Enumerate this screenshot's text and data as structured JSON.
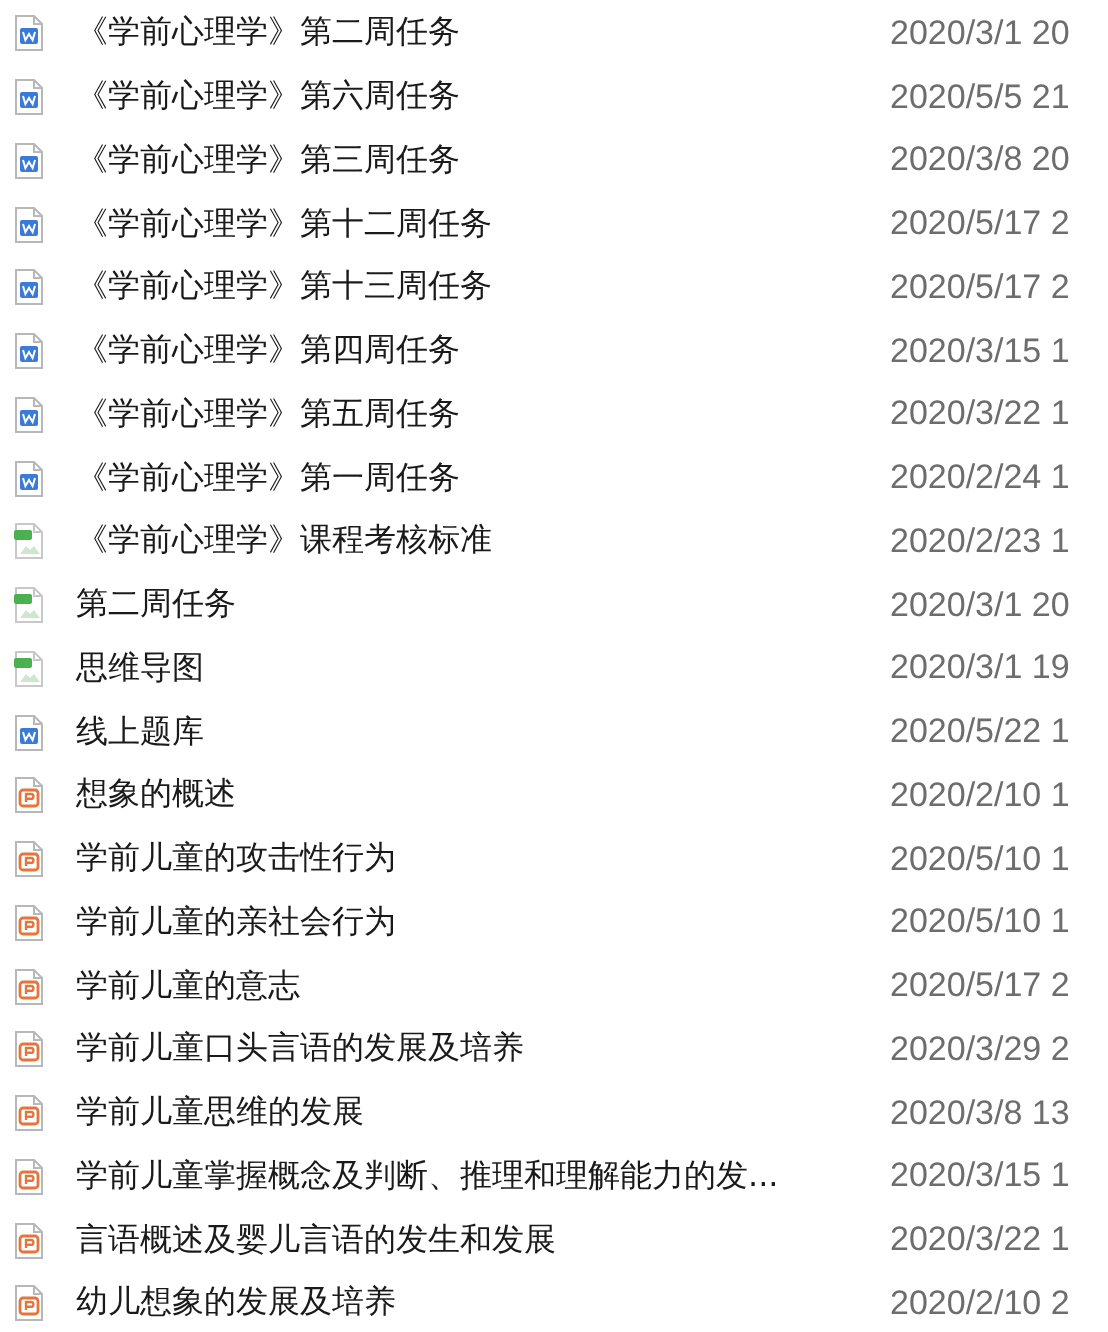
{
  "files": [
    {
      "kind": "word",
      "name": "《学前心理学》第二周任务",
      "date": "2020/3/1 20"
    },
    {
      "kind": "word",
      "name": "《学前心理学》第六周任务",
      "date": "2020/5/5 21"
    },
    {
      "kind": "word",
      "name": "《学前心理学》第三周任务",
      "date": "2020/3/8 20"
    },
    {
      "kind": "word",
      "name": "《学前心理学》第十二周任务",
      "date": "2020/5/17 2"
    },
    {
      "kind": "word",
      "name": "《学前心理学》第十三周任务",
      "date": "2020/5/17 2"
    },
    {
      "kind": "word",
      "name": "《学前心理学》第四周任务",
      "date": "2020/3/15 1"
    },
    {
      "kind": "word",
      "name": "《学前心理学》第五周任务",
      "date": "2020/3/22 1"
    },
    {
      "kind": "word",
      "name": "《学前心理学》第一周任务",
      "date": "2020/2/24 1"
    },
    {
      "kind": "image",
      "name": "《学前心理学》课程考核标准",
      "date": "2020/2/23 1"
    },
    {
      "kind": "image",
      "name": "第二周任务",
      "date": "2020/3/1 20"
    },
    {
      "kind": "image",
      "name": "思维导图",
      "date": "2020/3/1 19"
    },
    {
      "kind": "word",
      "name": "线上题库",
      "date": "2020/5/22 1"
    },
    {
      "kind": "slides",
      "name": "想象的概述",
      "date": "2020/2/10 1"
    },
    {
      "kind": "slides",
      "name": "学前儿童的攻击性行为",
      "date": "2020/5/10 1"
    },
    {
      "kind": "slides",
      "name": "学前儿童的亲社会行为",
      "date": "2020/5/10 1"
    },
    {
      "kind": "slides",
      "name": "学前儿童的意志",
      "date": "2020/5/17 2"
    },
    {
      "kind": "slides",
      "name": "学前儿童口头言语的发展及培养",
      "date": "2020/3/29 2"
    },
    {
      "kind": "slides",
      "name": "学前儿童思维的发展",
      "date": "2020/3/8 13"
    },
    {
      "kind": "slides",
      "name": "学前儿童掌握概念及判断、推理和理解能力的发...",
      "date": "2020/3/15 1"
    },
    {
      "kind": "slides",
      "name": "言语概述及婴儿言语的发生和发展",
      "date": "2020/3/22 1"
    },
    {
      "kind": "slides",
      "name": "幼儿想象的发展及培养",
      "date": "2020/2/10 2"
    }
  ]
}
